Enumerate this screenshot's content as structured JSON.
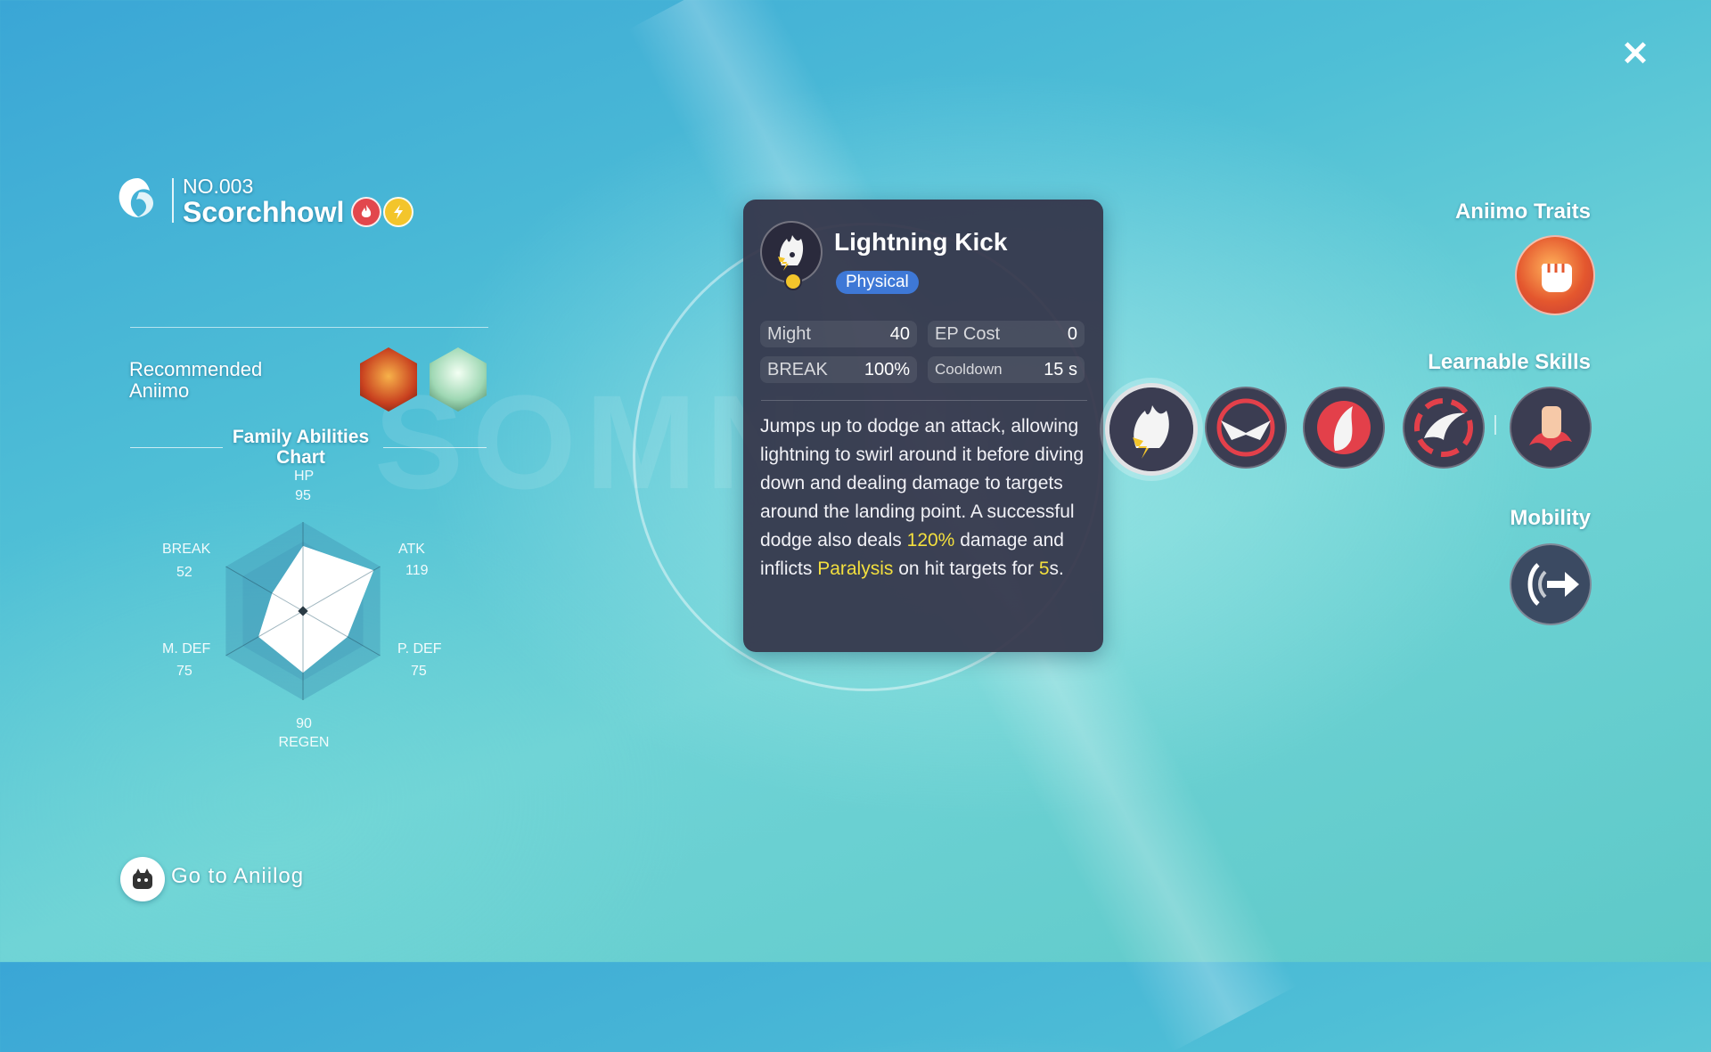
{
  "header": {
    "number": "NO.003",
    "name": "Scorchhowl",
    "types": [
      "fire",
      "electric"
    ]
  },
  "recommended": {
    "label_line1": "Recommended",
    "label_line2": "Aniimo"
  },
  "family_chart": {
    "title_line1": "Family Abilities",
    "title_line2": "Chart",
    "stats": [
      {
        "name": "HP",
        "value": "95"
      },
      {
        "name": "ATK",
        "value": "119"
      },
      {
        "name": "P. DEF",
        "value": "75"
      },
      {
        "name": "REGEN",
        "value": "90"
      },
      {
        "name": "M. DEF",
        "value": "75"
      },
      {
        "name": "BREAK",
        "value": "52"
      }
    ]
  },
  "chart_data": {
    "type": "radar",
    "categories": [
      "HP",
      "ATK",
      "P. DEF",
      "REGEN",
      "M. DEF",
      "BREAK"
    ],
    "values": [
      95,
      119,
      75,
      90,
      75,
      52
    ]
  },
  "skill_card": {
    "name": "Lightning Kick",
    "damage_type": "Physical",
    "might_label": "Might",
    "might_value": "40",
    "ep_label": "EP Cost",
    "ep_value": "0",
    "break_label": "BREAK",
    "break_value": "100%",
    "cooldown_label": "Cooldown",
    "cooldown_value": "15 s",
    "desc_part1": "Jumps up to dodge an attack, allowing lightning to swirl around it before diving down and dealing damage to targets around the landing point. A successful dodge also deals ",
    "desc_highlight1": "120%",
    "desc_part2": " damage and inflicts ",
    "desc_highlight2": "Paralysis",
    "desc_part3": " on hit targets for ",
    "desc_highlight3": "5",
    "desc_part4": "s."
  },
  "right_panel": {
    "traits_title": "Aniimo Traits",
    "skills_title": "Learnable Skills",
    "mobility_title": "Mobility"
  },
  "footer": {
    "aniilog_label": "Go to Aniilog"
  },
  "colors": {
    "fire": "#e2474d",
    "electric": "#f3c52b",
    "physical_badge": "#3e78d6",
    "highlight": "#f3df3e"
  }
}
